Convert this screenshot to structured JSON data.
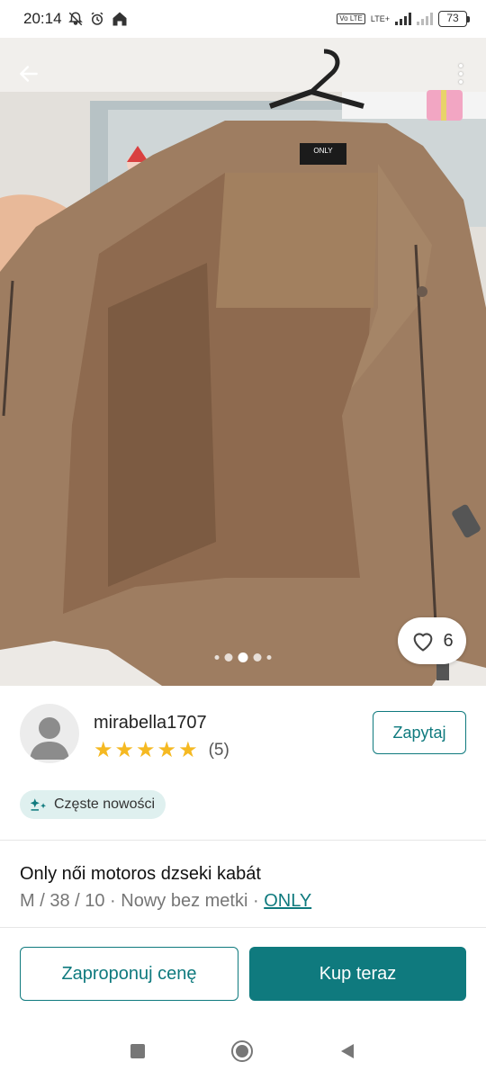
{
  "status_bar": {
    "time": "20:14",
    "network_label": "LTE+",
    "volte_label": "Vo LTE",
    "battery": "73"
  },
  "photo": {
    "label_brand": "ONLY",
    "current_image": 3,
    "image_count": 5,
    "like_count": "6"
  },
  "seller": {
    "username": "mirabella1707",
    "rating_stars": 5,
    "review_count": "(5)",
    "ask_label": "Zapytaj"
  },
  "badge": {
    "label": "Częste nowości"
  },
  "item": {
    "title": "Only női motoros dzseki kabát",
    "meta_prefix": "M / 38 / 10 · Nowy bez metki · ",
    "brand": "ONLY"
  },
  "actions": {
    "offer_label": "Zaproponuj cenę",
    "buy_label": "Kup teraz"
  },
  "colors": {
    "accent": "#0f7a7e",
    "star": "#f5b922",
    "badge_bg": "#dff0ef"
  }
}
